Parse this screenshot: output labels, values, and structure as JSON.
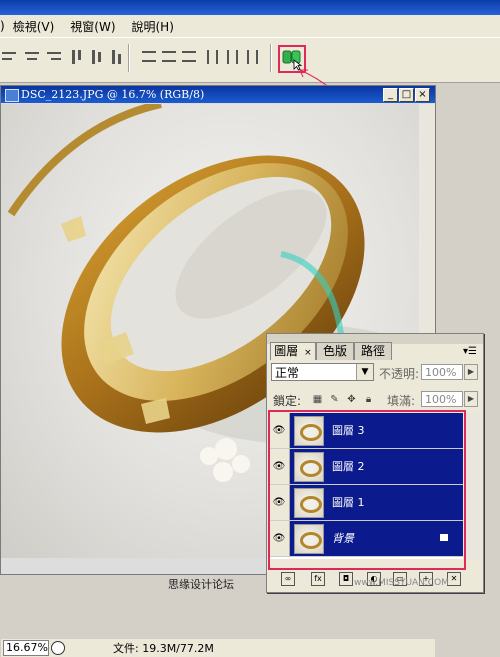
{
  "menu": {
    "item_prefix": ")",
    "view": "檢視(V)",
    "window": "視窗(W)",
    "help": "說明(H)"
  },
  "document": {
    "title": "DSC_2123.JPG @ 16.7% (RGB/8)",
    "zoom": "16.67%",
    "file_info": "文件: 19.3M/77.2M"
  },
  "layers_panel": {
    "tabs": [
      {
        "label": "圖層",
        "active": true
      },
      {
        "label": "色版",
        "active": false
      },
      {
        "label": "路徑",
        "active": false
      }
    ],
    "blend_mode": "正常",
    "opacity_label": "不透明:",
    "opacity_value": "100%",
    "lock_label": "鎖定:",
    "fill_label": "填滿:",
    "fill_value": "100%",
    "layers": [
      {
        "name": "圖層 3",
        "visible": true,
        "is_background": false
      },
      {
        "name": "圖層 2",
        "visible": true,
        "is_background": false
      },
      {
        "name": "圖層 1",
        "visible": true,
        "is_background": false
      },
      {
        "name": "背景",
        "visible": true,
        "is_background": true
      }
    ]
  },
  "watermark": {
    "text": "思缘设计论坛",
    "site": "www.MISSYUAN.COM"
  },
  "colors": {
    "layer_selected_bg": "#0b1a8c",
    "highlight_border": "#e0285a",
    "titlebar": "#0a35a0"
  }
}
